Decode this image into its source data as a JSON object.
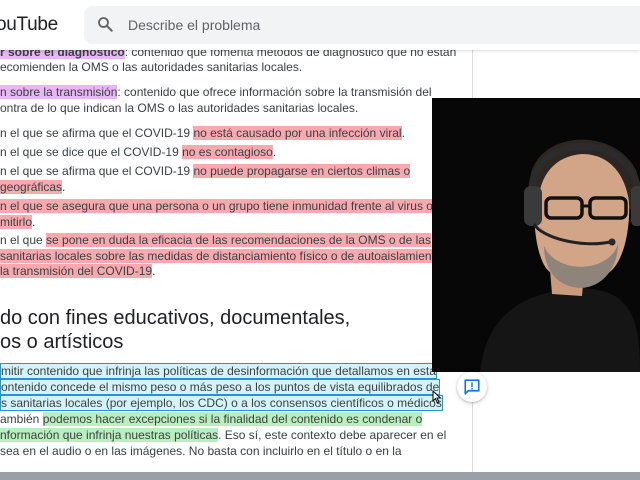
{
  "app": {
    "brand": "ouTube"
  },
  "search": {
    "placeholder": "Describe el problema"
  },
  "content": {
    "p1": {
      "l1a": "r sobre el diagnóstico",
      "l1b": ": contenido que fomenta métodos de diagnóstico que no están",
      "l2": "ecomienden la OMS o las autoridades sanitarias locales."
    },
    "p2": {
      "l1a": "n sobre la transmisión",
      "l1b": ": contenido que ofrece información sobre la transmisión del",
      "l2": "ontra de lo que indican la OMS o las autoridades sanitarias locales."
    },
    "b1": {
      "a": "n el que se afirma que el COVID-19 ",
      "b": "no está causado por una infección viral",
      "c": "."
    },
    "b2": {
      "a": "n el que se dice que el COVID-19 ",
      "b": "no es contagioso",
      "c": "."
    },
    "b3": {
      "a": "n el que se afirma que el COVID-19 ",
      "b": "no puede propagarse en ciertos climas o",
      "l2": "geográficas",
      "l2c": "."
    },
    "b4": {
      "l1": "n el que se asegura que una persona o un grupo tiene inmunidad frente al virus o no",
      "l2": "mitirlo",
      "l2c": "."
    },
    "b5": {
      "a": "n el que ",
      "b": "se pone en duda la eficacia de las recomendaciones de la OMS o de las",
      "l2": "sanitarias locales sobre las medidas de distanciamiento físico o de autoaislamiento",
      "l3": "la transmisión del COVID-19",
      "l3c": "."
    },
    "heading": {
      "l1": "do con fines educativos, documentales,",
      "l2": "os o artísticos"
    },
    "p3": {
      "l1": "mitir contenido que infrinja las políticas de desinformación que detallamos en esta",
      "l2": "ontenido concede el mismo peso o más peso a los puntos de vista equilibrados de",
      "l3": "s sanitarias locales (por ejemplo, los CDC) o a los consensos científicos o médicos",
      "l4a": "ambién ",
      "l4b": "podemos hacer excepciones si la finalidad del contenido es condenar o",
      "l5a": "nformación que infrinja nuestras políticas",
      "l5b": ". Eso sí, este contexto debe aparecer en el",
      "l6": "sea en el audio o en las imágenes. No basta con incluirlo en el título o en la"
    }
  }
}
